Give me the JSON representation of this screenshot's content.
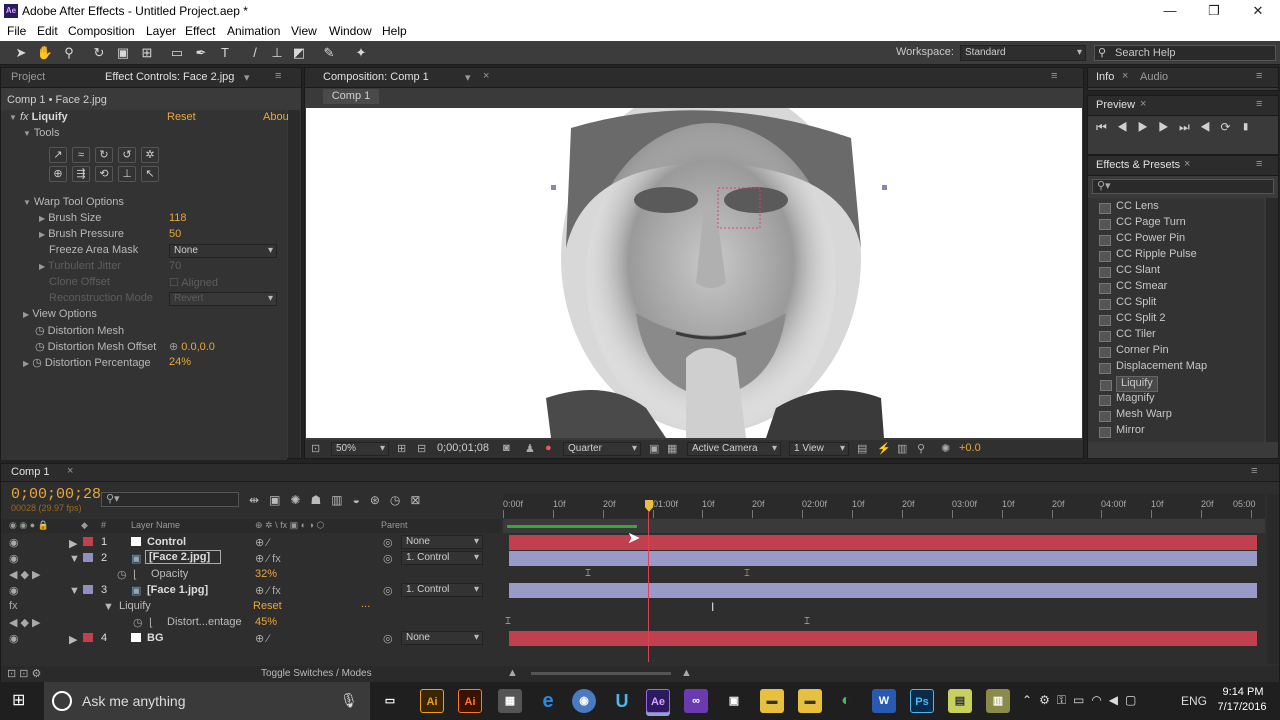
{
  "window": {
    "title": "Adobe After Effects - Untitled Project.aep *",
    "app_icon": "Ae",
    "minimize": "—",
    "maximize": "❐",
    "close": "✕"
  },
  "menu": [
    "File",
    "Edit",
    "Composition",
    "Layer",
    "Effect",
    "Animation",
    "View",
    "Window",
    "Help"
  ],
  "toolbar": {
    "workspace_label": "Workspace:",
    "workspace_value": "Standard",
    "search_placeholder": "Search Help"
  },
  "left_panel": {
    "tab_project": "Project",
    "tab_effect_controls": "Effect Controls: Face 2.jpg",
    "breadcrumb": "Comp 1 • Face 2.jpg",
    "effect_badge": "fx",
    "effect_name": "Liquify",
    "reset": "Reset",
    "about": "Abou",
    "tools_label": "Tools",
    "warp_tool_options": "Warp Tool Options",
    "brush_size_label": "Brush Size",
    "brush_size": "118",
    "brush_pressure_label": "Brush Pressure",
    "brush_pressure": "50",
    "freeze_area_mask_label": "Freeze Area Mask",
    "freeze_area_mask": "None",
    "turbulent_jitter_label": "Turbulent Jitter",
    "turbulent_jitter": "70",
    "clone_offset_label": "Clone Offset",
    "aligned": "Aligned",
    "reconstruction_mode_label": "Reconstruction Mode",
    "reconstruction_mode": "Revert",
    "view_options": "View Options",
    "distortion_mesh": "Distortion Mesh",
    "distortion_mesh_offset_label": "Distortion Mesh Offset",
    "distortion_mesh_offset": "0.0,0.0",
    "distortion_percentage_label": "Distortion Percentage",
    "distortion_percentage": "24%"
  },
  "comp_panel": {
    "tab": "Composition: Comp 1",
    "sub_tab": "Comp 1",
    "zoom": "50%",
    "timecode": "0;00;01;08",
    "resolution": "Quarter",
    "camera": "Active Camera",
    "view": "1 View",
    "exposure": "+0.0"
  },
  "right_panel": {
    "tab_info": "Info",
    "tab_audio": "Audio",
    "tab_preview": "Preview",
    "tab_effects_presets": "Effects & Presets",
    "effects_list": [
      "CC Lens",
      "CC Page Turn",
      "CC Power Pin",
      "CC Ripple Pulse",
      "CC Slant",
      "CC Smear",
      "CC Split",
      "CC Split 2",
      "CC Tiler",
      "Corner Pin",
      "Displacement Map",
      "Liquify",
      "Magnify",
      "Mesh Warp",
      "Mirror"
    ],
    "selected_effect": "Liquify"
  },
  "timeline": {
    "tab": "Comp 1",
    "timecode": "0;00;00;28",
    "fps_note": "00028 (29.97 fps)",
    "col_hash": "#",
    "col_layer_name": "Layer Name",
    "col_parent": "Parent",
    "ruler": [
      "0:00f",
      "10f",
      "20f",
      "01:00f",
      "10f",
      "20f",
      "02:00f",
      "10f",
      "20f",
      "03:00f",
      "10f",
      "20f",
      "04:00f",
      "10f",
      "20f",
      "05:00"
    ],
    "layers": [
      {
        "num": "1",
        "name": "Control",
        "parent": "None",
        "color": "#c04050"
      },
      {
        "num": "2",
        "name": "[Face 2.jpg]",
        "parent": "1. Control",
        "color": "#9090c0"
      },
      {
        "prop": "Opacity",
        "value": "32%"
      },
      {
        "num": "3",
        "name": "[Face 1.jpg]",
        "parent": "1. Control",
        "color": "#9090c0"
      },
      {
        "sub": "Liquify",
        "reset": "Reset",
        "dots": "..."
      },
      {
        "prop": "Distort...entage",
        "value": "45%"
      },
      {
        "num": "4",
        "name": "BG",
        "parent": "None",
        "color": "#c04050"
      }
    ],
    "toggle_label": "Toggle Switches / Modes"
  },
  "taskbar": {
    "search": "Ask me anything",
    "lang": "ENG",
    "time": "9:14 PM",
    "date": "7/17/2016",
    "apps": [
      "Ai",
      "Ai",
      "Ae",
      "Ps"
    ]
  },
  "colors": {
    "accent": "#e8a83a",
    "label_red": "#c04050",
    "label_purple": "#9090c0",
    "playhead": "#e04050"
  }
}
